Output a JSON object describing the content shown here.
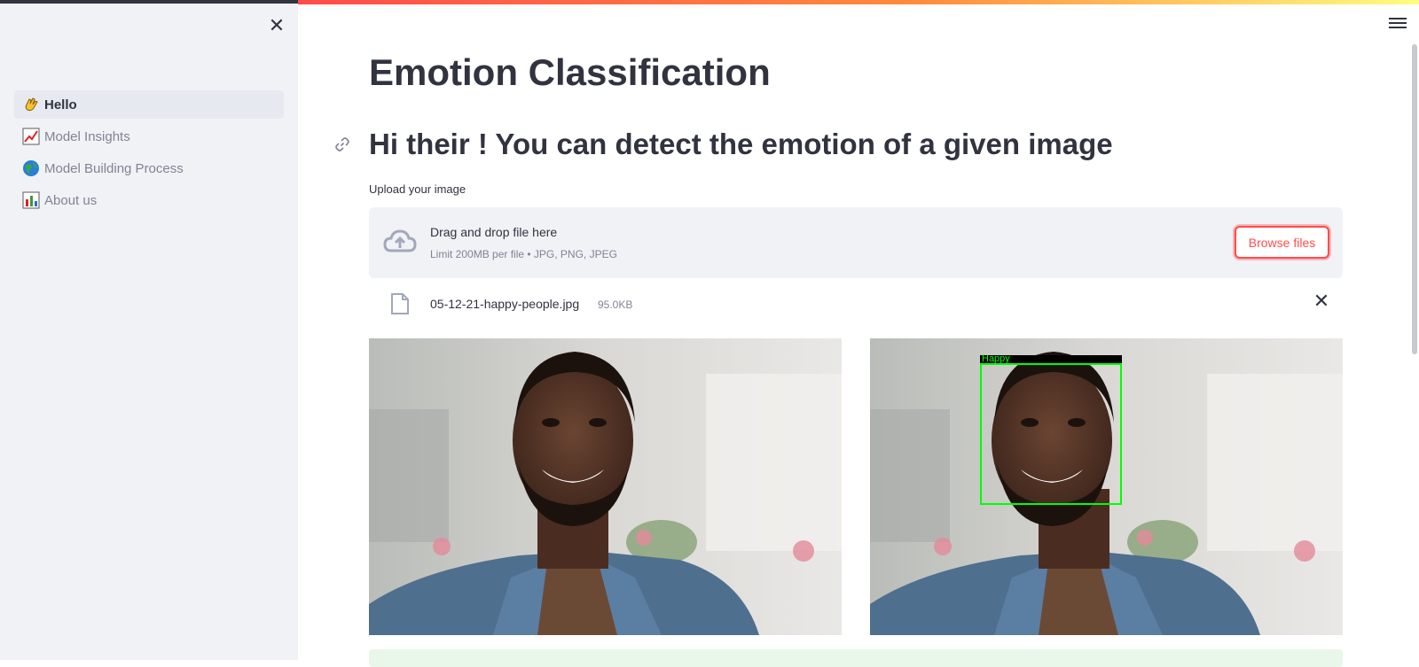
{
  "sidebar": {
    "items": [
      {
        "label": "Hello",
        "icon": "waving-hand-icon",
        "active": true
      },
      {
        "label": "Model Insights",
        "icon": "chart-increasing-icon",
        "active": false
      },
      {
        "label": "Model Building Process",
        "icon": "globe-icon",
        "active": false
      },
      {
        "label": "About us",
        "icon": "bar-chart-icon",
        "active": false
      }
    ]
  },
  "main": {
    "title": "Emotion Classification",
    "subheading": "Hi their ! You can detect the emotion of a given image",
    "upload": {
      "label": "Upload your image",
      "dropzone_title": "Drag and drop file here",
      "dropzone_limit": "Limit 200MB per file • JPG, PNG, JPEG",
      "browse_label": "Browse files"
    },
    "file": {
      "name": "05-12-21-happy-people.jpg",
      "size": "95.0KB"
    },
    "prediction": {
      "label": "Happy"
    }
  },
  "colors": {
    "accent": "#ff4b4b",
    "sidebar_bg": "#f0f2f6",
    "text": "#31333f",
    "detection_box": "#00ff00"
  }
}
